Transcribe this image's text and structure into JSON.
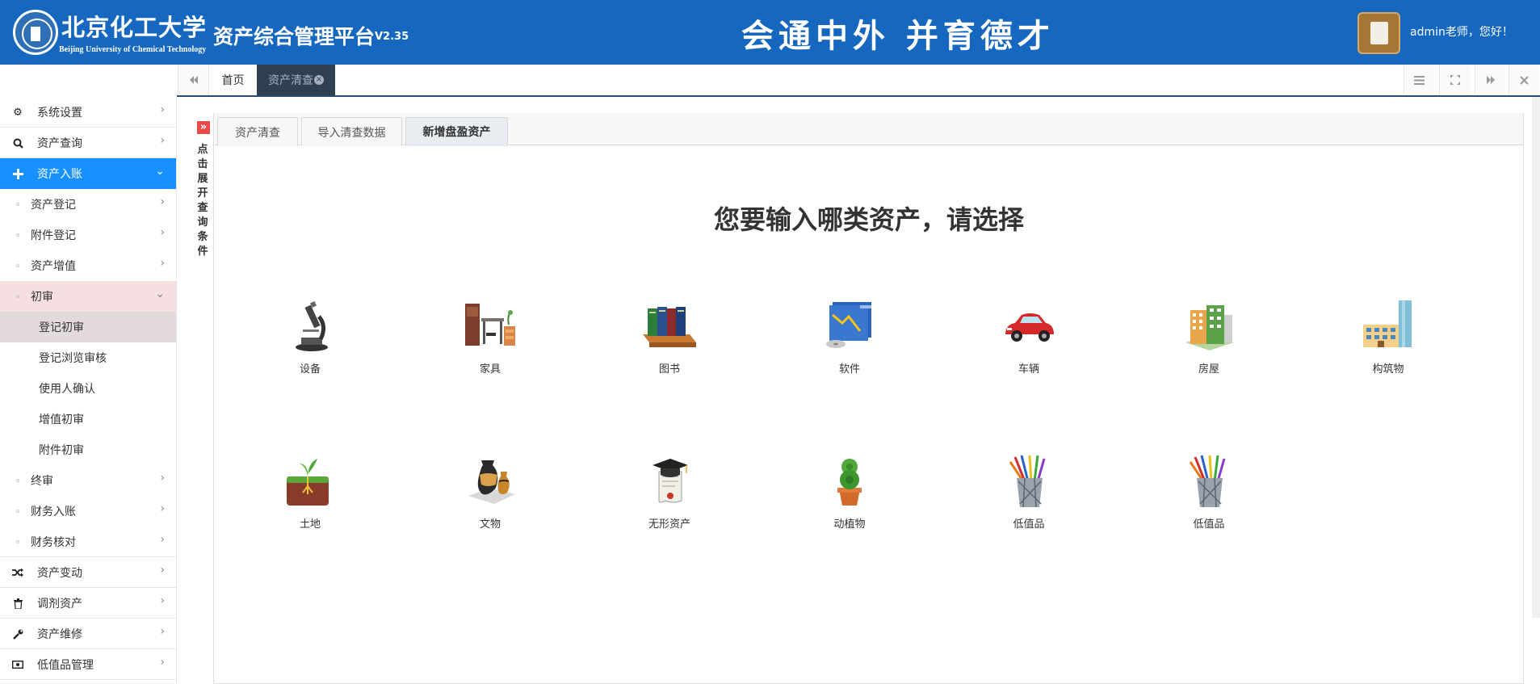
{
  "header": {
    "uni_name": "北京化工大学",
    "uni_en": "Beijing University of Chemical Technology",
    "platform": "资产综合管理平台",
    "version": "V2.35",
    "motto": "会通中外 并育德才",
    "greeting": "admin老师，您好！"
  },
  "tabbar": {
    "home": "首页",
    "active_tab": "资产清查"
  },
  "sidebar": {
    "items": [
      {
        "label": "系统设置",
        "icon": "gear-icon"
      },
      {
        "label": "资产查询",
        "icon": "search-icon"
      },
      {
        "label": "资产入账",
        "icon": "plus-icon"
      }
    ],
    "sub_items": [
      {
        "label": "资产登记"
      },
      {
        "label": "附件登记"
      },
      {
        "label": "资产增值"
      },
      {
        "label": "初审"
      }
    ],
    "sub_sub_items": [
      {
        "label": "登记初审"
      },
      {
        "label": "登记浏览审核"
      },
      {
        "label": "使用人确认"
      },
      {
        "label": "增值初审"
      },
      {
        "label": "附件初审"
      }
    ],
    "sub_items_after": [
      {
        "label": "终审"
      },
      {
        "label": "财务入账"
      },
      {
        "label": "财务核对"
      }
    ],
    "items_after": [
      {
        "label": "资产变动",
        "icon": "shuffle-icon"
      },
      {
        "label": "调剂资产",
        "icon": "trash-icon"
      },
      {
        "label": "资产维修",
        "icon": "wrench-icon"
      },
      {
        "label": "低值品管理",
        "icon": "money-icon"
      }
    ]
  },
  "toggle": {
    "chars": [
      "点",
      "击",
      "展",
      "开",
      "查",
      "询",
      "条",
      "件"
    ]
  },
  "content_tabs": [
    {
      "label": "资产清查"
    },
    {
      "label": "导入清查数据"
    },
    {
      "label": "新增盘盈资产"
    }
  ],
  "main": {
    "title": "您要输入哪类资产，请选择",
    "assets_row1": [
      {
        "label": "设备",
        "icon": "microscope-icon"
      },
      {
        "label": "家具",
        "icon": "furniture-icon"
      },
      {
        "label": "图书",
        "icon": "books-icon"
      },
      {
        "label": "软件",
        "icon": "software-icon"
      },
      {
        "label": "车辆",
        "icon": "car-icon"
      },
      {
        "label": "房屋",
        "icon": "house-icon"
      },
      {
        "label": "构筑物",
        "icon": "building-icon"
      }
    ],
    "assets_row2": [
      {
        "label": "土地",
        "icon": "land-icon"
      },
      {
        "label": "文物",
        "icon": "vase-icon"
      },
      {
        "label": "无形资产",
        "icon": "diploma-icon"
      },
      {
        "label": "动植物",
        "icon": "plant-icon"
      },
      {
        "label": "低值品",
        "icon": "pencil-cup-icon"
      },
      {
        "label": "低值品",
        "icon": "pencil-cup-icon"
      }
    ]
  }
}
